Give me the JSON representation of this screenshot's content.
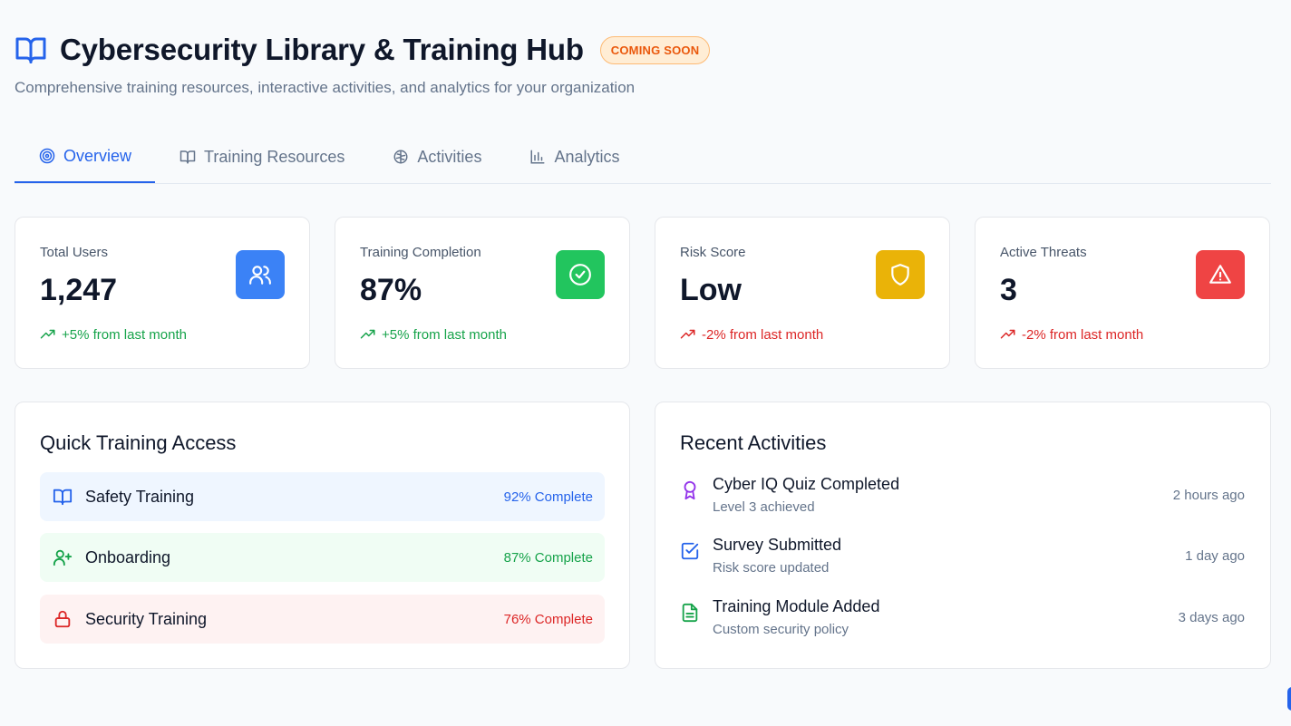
{
  "header": {
    "icon": "book-open-icon",
    "title": "Cybersecurity Library & Training Hub",
    "badge": "COMING SOON",
    "subtitle": "Comprehensive training resources, interactive activities, and analytics for your organization"
  },
  "tabs": [
    {
      "label": "Overview",
      "icon": "target-icon",
      "active": true
    },
    {
      "label": "Training Resources",
      "icon": "book-open-icon",
      "active": false
    },
    {
      "label": "Activities",
      "icon": "brain-icon",
      "active": false
    },
    {
      "label": "Analytics",
      "icon": "bar-chart-icon",
      "active": false
    }
  ],
  "stats": [
    {
      "label": "Total Users",
      "value": "1,247",
      "trend": "+5% from last month",
      "trend_dir": "up",
      "icon": "users-icon",
      "color": "#3b82f6"
    },
    {
      "label": "Training Completion",
      "value": "87%",
      "trend": "+5% from last month",
      "trend_dir": "up",
      "icon": "check-circle-icon",
      "color": "#22c55e"
    },
    {
      "label": "Risk Score",
      "value": "Low",
      "trend": "-2% from last month",
      "trend_dir": "down",
      "icon": "shield-icon",
      "color": "#eab308"
    },
    {
      "label": "Active Threats",
      "value": "3",
      "trend": "-2% from last month",
      "trend_dir": "down",
      "icon": "alert-triangle-icon",
      "color": "#ef4444"
    }
  ],
  "quick_access": {
    "title": "Quick Training Access",
    "items": [
      {
        "label": "Safety Training",
        "progress": "92% Complete",
        "icon": "book-open-icon",
        "bg": "#eff6ff",
        "color": "#2563eb"
      },
      {
        "label": "Onboarding",
        "progress": "87% Complete",
        "icon": "user-plus-icon",
        "bg": "#f0fdf4",
        "color": "#16a34a"
      },
      {
        "label": "Security Training",
        "progress": "76% Complete",
        "icon": "lock-icon",
        "bg": "#fef2f2",
        "color": "#dc2626"
      }
    ]
  },
  "recent": {
    "title": "Recent Activities",
    "items": [
      {
        "title": "Cyber IQ Quiz Completed",
        "subtitle": "Level 3 achieved",
        "time": "2 hours ago",
        "icon": "award-icon",
        "color": "#9333ea"
      },
      {
        "title": "Survey Submitted",
        "subtitle": "Risk score updated",
        "time": "1 day ago",
        "icon": "check-square-icon",
        "color": "#2563eb"
      },
      {
        "title": "Training Module Added",
        "subtitle": "Custom security policy",
        "time": "3 days ago",
        "icon": "file-text-icon",
        "color": "#16a34a"
      }
    ]
  }
}
